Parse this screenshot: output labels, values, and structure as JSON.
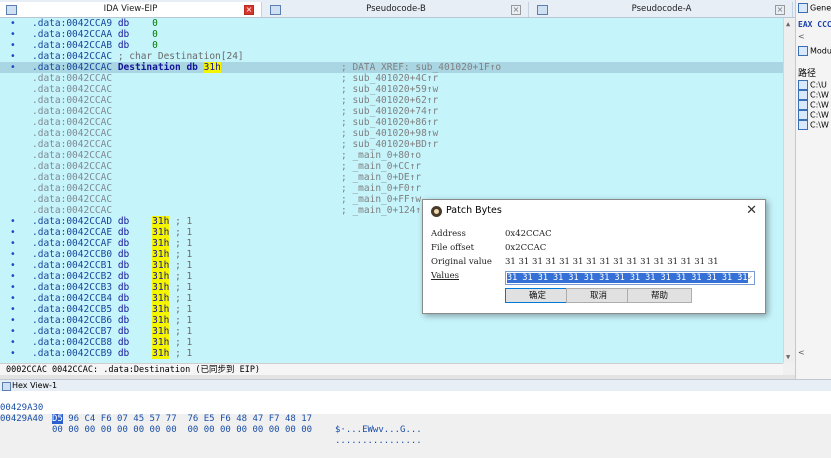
{
  "tabs": [
    {
      "label": "IDA View-EIP"
    },
    {
      "label": "Pseudocode-B"
    },
    {
      "label": "Pseudocode-A"
    }
  ],
  "disasm": {
    "rows": [
      {
        "addr": ".data:0042CCA9",
        "mnem": "db",
        "val": "0",
        "cmt": "",
        "type": "db"
      },
      {
        "addr": ".data:0042CCAA",
        "mnem": "db",
        "val": "0",
        "cmt": "",
        "type": "db"
      },
      {
        "addr": ".data:0042CCAB",
        "mnem": "db",
        "val": "0",
        "cmt": "",
        "type": "db"
      },
      {
        "addr": ".data:0042CCAC",
        "mnem": "; char Destination[24]",
        "val": "",
        "cmt": "",
        "type": "comment"
      },
      {
        "addr": ".data:0042CCAC",
        "mnem": "Destination db",
        "val": "31h",
        "cmt": "; DATA XREF: sub_401020+1F↑o",
        "type": "head"
      },
      {
        "addr": ".data:0042CCAC",
        "mnem": "",
        "val": "",
        "cmt": "; sub_401020+4C↑r",
        "type": "xref"
      },
      {
        "addr": ".data:0042CCAC",
        "mnem": "",
        "val": "",
        "cmt": "; sub_401020+59↑w",
        "type": "xref"
      },
      {
        "addr": ".data:0042CCAC",
        "mnem": "",
        "val": "",
        "cmt": "; sub_401020+62↑r",
        "type": "xref"
      },
      {
        "addr": ".data:0042CCAC",
        "mnem": "",
        "val": "",
        "cmt": "; sub_401020+74↑r",
        "type": "xref"
      },
      {
        "addr": ".data:0042CCAC",
        "mnem": "",
        "val": "",
        "cmt": "; sub_401020+86↑r",
        "type": "xref"
      },
      {
        "addr": ".data:0042CCAC",
        "mnem": "",
        "val": "",
        "cmt": "; sub_401020+98↑w",
        "type": "xref"
      },
      {
        "addr": ".data:0042CCAC",
        "mnem": "",
        "val": "",
        "cmt": "; sub_401020+BD↑r",
        "type": "xref"
      },
      {
        "addr": ".data:0042CCAC",
        "mnem": "",
        "val": "",
        "cmt": "; _main_0+80↑o",
        "type": "xref"
      },
      {
        "addr": ".data:0042CCAC",
        "mnem": "",
        "val": "",
        "cmt": "; _main_0+CC↑r",
        "type": "xref"
      },
      {
        "addr": ".data:0042CCAC",
        "mnem": "",
        "val": "",
        "cmt": "; _main_0+DE↑r",
        "type": "xref"
      },
      {
        "addr": ".data:0042CCAC",
        "mnem": "",
        "val": "",
        "cmt": "; _main_0+F0↑r",
        "type": "xref"
      },
      {
        "addr": ".data:0042CCAC",
        "mnem": "",
        "val": "",
        "cmt": "; _main_0+FF↑w",
        "type": "xref"
      },
      {
        "addr": ".data:0042CCAC",
        "mnem": "",
        "val": "",
        "cmt": "; _main_0+124↑r",
        "type": "xref"
      },
      {
        "addr": ".data:0042CCAD",
        "mnem": "db",
        "val": "31h",
        "cmt": "; 1",
        "type": "db1"
      },
      {
        "addr": ".data:0042CCAE",
        "mnem": "db",
        "val": "31h",
        "cmt": "; 1",
        "type": "db1"
      },
      {
        "addr": ".data:0042CCAF",
        "mnem": "db",
        "val": "31h",
        "cmt": "; 1",
        "type": "db1"
      },
      {
        "addr": ".data:0042CCB0",
        "mnem": "db",
        "val": "31h",
        "cmt": "; 1",
        "type": "db1"
      },
      {
        "addr": ".data:0042CCB1",
        "mnem": "db",
        "val": "31h",
        "cmt": "; 1",
        "type": "db1"
      },
      {
        "addr": ".data:0042CCB2",
        "mnem": "db",
        "val": "31h",
        "cmt": "; 1",
        "type": "db1"
      },
      {
        "addr": ".data:0042CCB3",
        "mnem": "db",
        "val": "31h",
        "cmt": "; 1",
        "type": "db1"
      },
      {
        "addr": ".data:0042CCB4",
        "mnem": "db",
        "val": "31h",
        "cmt": "; 1",
        "type": "db1"
      },
      {
        "addr": ".data:0042CCB5",
        "mnem": "db",
        "val": "31h",
        "cmt": "; 1",
        "type": "db1"
      },
      {
        "addr": ".data:0042CCB6",
        "mnem": "db",
        "val": "31h",
        "cmt": "; 1",
        "type": "db1"
      },
      {
        "addr": ".data:0042CCB7",
        "mnem": "db",
        "val": "31h",
        "cmt": "; 1",
        "type": "db1"
      },
      {
        "addr": ".data:0042CCB8",
        "mnem": "db",
        "val": "31h",
        "cmt": "; 1",
        "type": "db1"
      },
      {
        "addr": ".data:0042CCB9",
        "mnem": "db",
        "val": "31h",
        "cmt": "; 1",
        "type": "db1"
      }
    ],
    "status": "0002CCAC 0042CCAC: .data:Destination (已同步到 EIP)"
  },
  "hex": {
    "title": "Hex View-1",
    "rows": [
      {
        "addr": "00429A30",
        "first": "D5",
        "bytes": " 96 C4 F6 07 45 57 77  76 E5 F6 48 47 F7 48 17",
        "ascii": "$·...EWwv...G..."
      },
      {
        "addr": "00429A40",
        "first": "00",
        "bytes": " 00 00 00 00 00 00 00  00 00 00 00 00 00 00 00",
        "ascii": "................"
      }
    ]
  },
  "right_panel": {
    "header": "Gener",
    "reg": "EAX CCC",
    "module": "Modul",
    "path_label": "路径",
    "paths": [
      "C:\\U",
      "C:\\W",
      "C:\\W",
      "C:\\W",
      "C:\\W"
    ]
  },
  "dialog": {
    "title": "Patch Bytes",
    "fields": [
      {
        "label": "Address",
        "value": "0x42CCAC"
      },
      {
        "label": "File offset",
        "value": "0x2CCAC"
      },
      {
        "label": "Original value",
        "value": "31 31 31 31 31 31 31 31 31 31 31 31 31 31 31 31"
      }
    ],
    "values_label": "Values",
    "values_value": "31 31 31 31 31 31 31 31 31 31 31 31 31 31 31 31",
    "ok": "确定",
    "cancel": "取消",
    "help": "帮助"
  }
}
